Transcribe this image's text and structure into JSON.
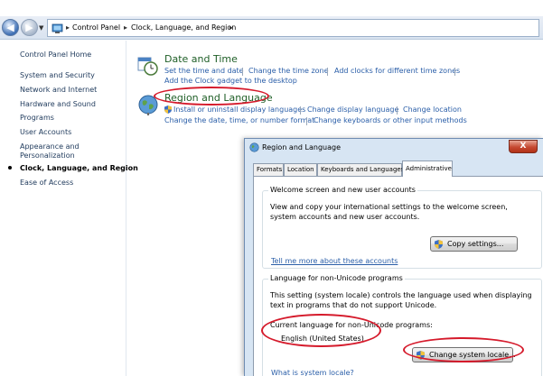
{
  "address_bar": {
    "crumbs": [
      "Control Panel",
      "Clock, Language, and Region"
    ]
  },
  "sidebar": {
    "items": [
      {
        "label": "Control Panel Home"
      },
      {
        "label": "System and Security"
      },
      {
        "label": "Network and Internet"
      },
      {
        "label": "Hardware and Sound"
      },
      {
        "label": "Programs"
      },
      {
        "label": "User Accounts"
      },
      {
        "label": "Appearance and"
      },
      {
        "label": "Personalization"
      },
      {
        "label": "Clock, Language, and Region"
      },
      {
        "label": "Ease of Access"
      }
    ]
  },
  "categories": {
    "date_time": {
      "title": "Date and Time",
      "links": [
        "Set the time and date",
        "Change the time zone",
        "Add clocks for different time zones",
        "Add the Clock gadget to the desktop"
      ]
    },
    "region_language": {
      "title": "Region and Language",
      "links": [
        "Install or uninstall display languages",
        "Change display language",
        "Change location",
        "Change the date, time, or number format",
        "Change keyboards or other input methods"
      ]
    }
  },
  "dialog": {
    "title": "Region and Language",
    "close_label": "X",
    "tabs": [
      "Formats",
      "Location",
      "Keyboards and Languages",
      "Administrative"
    ],
    "welcome_group": {
      "label": "Welcome screen and new user accounts",
      "description": "View and copy your international settings to the welcome screen, system accounts and new user accounts.",
      "button": "Copy settings...",
      "link": "Tell me more about these accounts"
    },
    "non_unicode_group": {
      "label": "Language for non-Unicode programs",
      "description": "This setting (system locale) controls the language used when displaying text in programs that do not support Unicode.",
      "current_label": "Current language for non-Unicode programs:",
      "current_value": "English (United States)",
      "button": "Change system locale...",
      "link": "What is system locale?"
    }
  },
  "colors": {
    "link": "#2a5ea8",
    "category_title": "#1e5e26",
    "annotation": "#d51a2b"
  }
}
